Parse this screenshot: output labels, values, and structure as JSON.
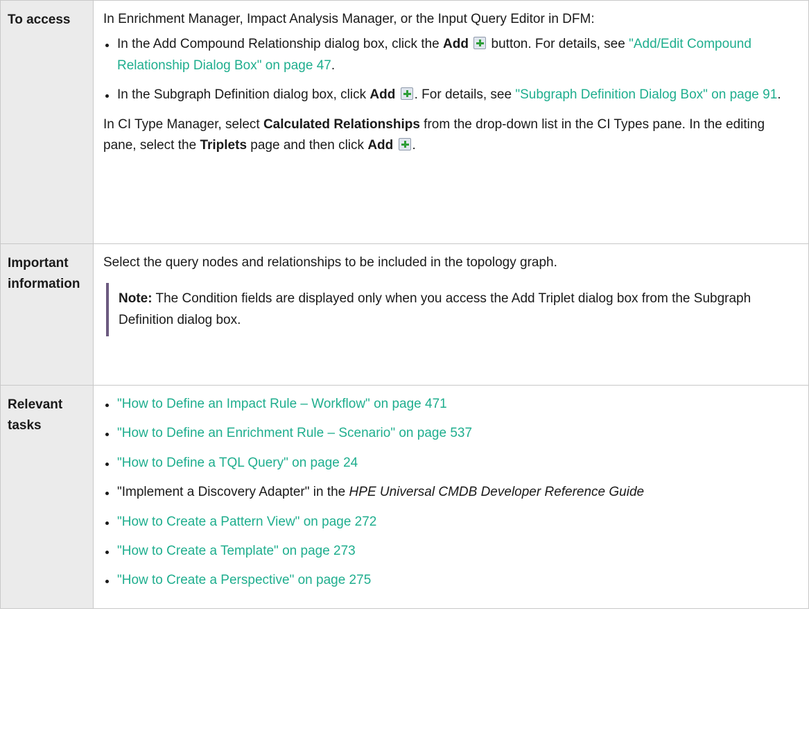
{
  "rows": {
    "access": {
      "label": "To access",
      "intro": "In Enrichment Manager, Impact Analysis Manager, or the Input Query Editor in DFM:",
      "bullet1": {
        "t1": "In the Add Compound Relationship dialog box, click the ",
        "bold": "Add",
        "icon": "add-plus-icon",
        "t2": " button. For details, see ",
        "link": "\"Add/Edit Compound Relationship Dialog Box\" on page 47",
        "t3": "."
      },
      "bullet2": {
        "t1": "In the Subgraph Definition dialog box, click ",
        "bold": "Add",
        "icon": "add-plus-icon",
        "t2": ". For details, see ",
        "link": "\"Subgraph Definition Dialog Box\" on page 91",
        "t3": "."
      },
      "para": {
        "t1": "In CI Type Manager, select ",
        "bold1": "Calculated Relationships",
        "t2": " from the drop-down list in the CI Types pane. In the editing pane, select the ",
        "bold2": "Triplets",
        "t3": " page and then click ",
        "bold3": "Add",
        "icon": "add-plus-icon",
        "t4": "."
      }
    },
    "important": {
      "label": "Important information",
      "text": "Select the query nodes and relationships to be included in the topology graph.",
      "note": {
        "label": "Note:",
        "text": " The Condition fields are displayed only when you access the Add Triplet dialog box from the Subgraph Definition dialog box."
      }
    },
    "tasks": {
      "label": "Relevant tasks",
      "link1": "\"How to Define an Impact Rule – Workflow\" on page 471",
      "link2": "\"How to Define an Enrichment Rule – Scenario\" on page 537",
      "link3": "\"How to Define a TQL Query\" on page 24",
      "item4": {
        "t1": "\"Implement a Discovery Adapter\" in the ",
        "italic": "HPE Universal CMDB Developer Reference Guide"
      },
      "link5": "\"How to Create a Pattern View\" on page 272",
      "link6": "\"How to Create a Template\" on page 273",
      "link7": "\"How to Create a Perspective\" on page 275"
    }
  },
  "colors": {
    "link": "#1fae8e",
    "label_bg": "#ebebeb",
    "note_bar": "#6c5a80",
    "border": "#c8c8c8"
  }
}
